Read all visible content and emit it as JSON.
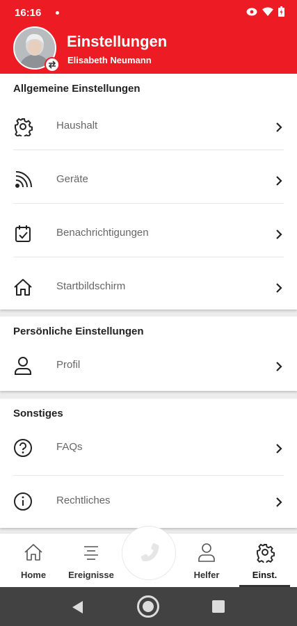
{
  "status": {
    "time": "16:16"
  },
  "header": {
    "title": "Einstellungen",
    "subtitle": "Elisabeth Neumann"
  },
  "sections": [
    {
      "title": "Allgemeine Einstellungen",
      "items": [
        {
          "label": "Haushalt",
          "icon": "gear-icon"
        },
        {
          "label": "Geräte",
          "icon": "rss-icon"
        },
        {
          "label": "Benachrichtigungen",
          "icon": "calendar-check-icon"
        },
        {
          "label": "Startbildschirm",
          "icon": "home-icon"
        }
      ]
    },
    {
      "title": "Persönliche Einstellungen",
      "items": [
        {
          "label": "Profil",
          "icon": "user-icon"
        }
      ]
    },
    {
      "title": "Sonstiges",
      "items": [
        {
          "label": "FAQs",
          "icon": "question-circle-icon"
        },
        {
          "label": "Rechtliches",
          "icon": "info-circle-icon"
        }
      ]
    }
  ],
  "bottom_nav": {
    "items": [
      {
        "label": "Home",
        "icon": "home-icon"
      },
      {
        "label": "Ereignisse",
        "icon": "list-icon"
      },
      {
        "label": "Helfer",
        "icon": "user-icon"
      },
      {
        "label": "Einst.",
        "icon": "gear-icon"
      }
    ],
    "active": "Einst.",
    "center_button_icon": "phone-icon"
  },
  "colors": {
    "brand": "#ed1c24",
    "system_nav": "#424242"
  }
}
